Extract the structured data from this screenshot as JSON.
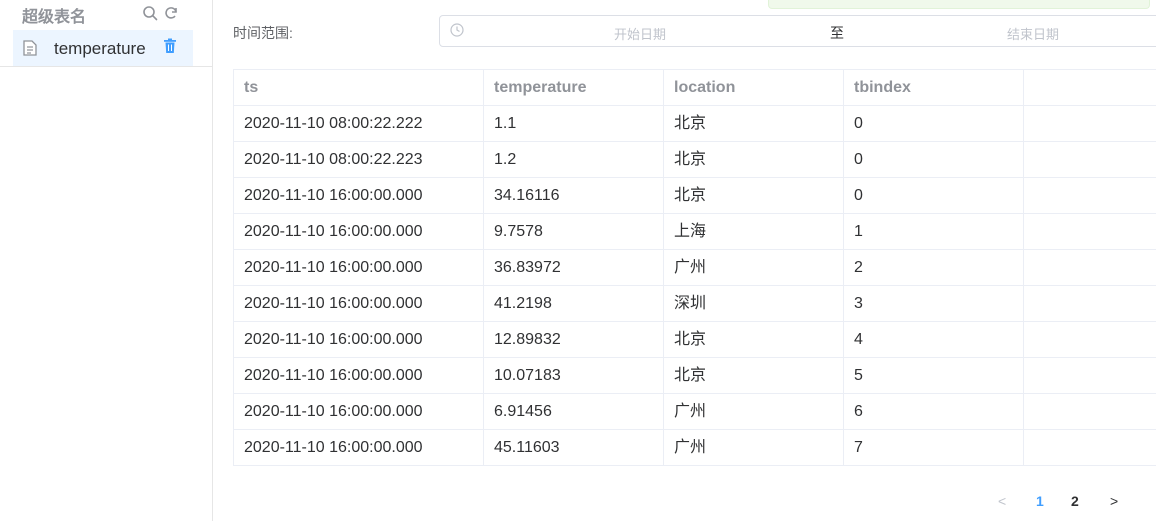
{
  "sidebar": {
    "title": "超级表名",
    "items": [
      {
        "label": "temperature"
      }
    ]
  },
  "filter": {
    "label": "时间范围:",
    "start_placeholder": "开始日期",
    "separator": "至",
    "end_placeholder": "结束日期"
  },
  "table": {
    "columns": [
      "ts",
      "temperature",
      "location",
      "tbindex"
    ],
    "rows": [
      [
        "2020-11-10 08:00:22.222",
        "1.1",
        "北京",
        "0"
      ],
      [
        "2020-11-10 08:00:22.223",
        "1.2",
        "北京",
        "0"
      ],
      [
        "2020-11-10 16:00:00.000",
        "34.16116",
        "北京",
        "0"
      ],
      [
        "2020-11-10 16:00:00.000",
        "9.7578",
        "上海",
        "1"
      ],
      [
        "2020-11-10 16:00:00.000",
        "36.83972",
        "广州",
        "2"
      ],
      [
        "2020-11-10 16:00:00.000",
        "41.2198",
        "深圳",
        "3"
      ],
      [
        "2020-11-10 16:00:00.000",
        "12.89832",
        "北京",
        "4"
      ],
      [
        "2020-11-10 16:00:00.000",
        "10.07183",
        "北京",
        "5"
      ],
      [
        "2020-11-10 16:00:00.000",
        "6.91456",
        "广州",
        "6"
      ],
      [
        "2020-11-10 16:00:00.000",
        "45.11603",
        "广州",
        "7"
      ]
    ]
  },
  "pagination": {
    "pages": [
      "1",
      "2"
    ],
    "current": "1",
    "prev_icon": "<",
    "next_icon": ">"
  },
  "colors": {
    "accent": "#409eff",
    "selected_bg": "#ecf5ff",
    "muted": "#909399"
  }
}
